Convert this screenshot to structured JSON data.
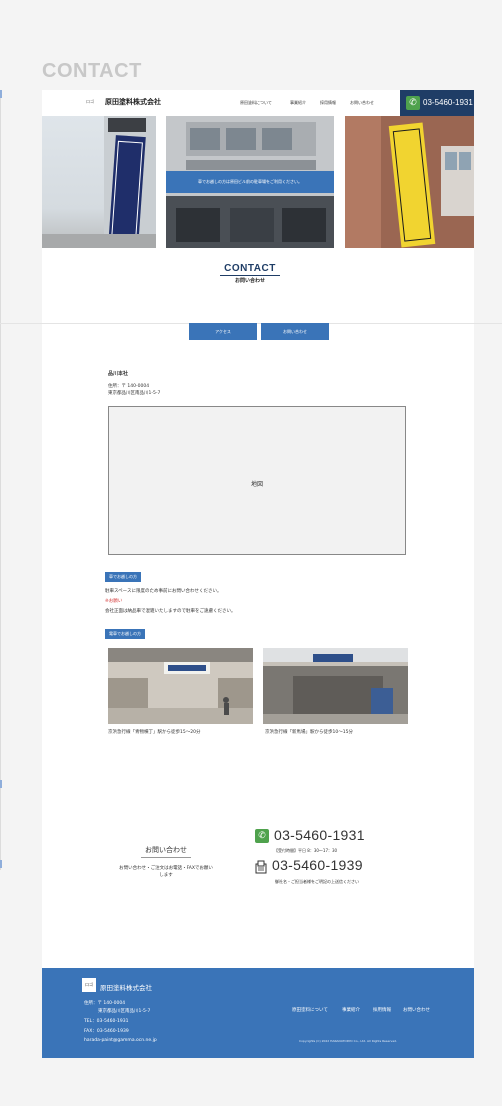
{
  "page_label": "CONTACT",
  "header": {
    "logo": "ロゴ",
    "brand": "原田塗料株式会社",
    "nav": [
      "原田塗料について",
      "事業紹介",
      "採用情報",
      "お問い合わせ"
    ],
    "tel": "03-5460-1931"
  },
  "hero": {
    "notice": "車でお越しの方は原田ビル前の駐車場をご利用ください。"
  },
  "section": {
    "title_en": "CONTACT",
    "title_jp": "お問い合わせ"
  },
  "tabs": [
    "アクセス",
    "お問い合わせ"
  ],
  "access": {
    "branch": "品川本社",
    "zip": "住所：〒 140-0004",
    "address": "東京都品川区南品川1-5-7",
    "map_label": "地図",
    "car_label": "車でお越しの方",
    "car_text1": "駐車スペースに限度のため事前にお問い合わせください。",
    "car_warning": "※お願い",
    "car_text2": "会社正面は納品車で混雑いたしますので駐車をご遠慮ください。",
    "train_label": "電車でお越しの方",
    "train_caption1": "京浜急行線「青物横丁」駅から徒歩15〜20分",
    "train_caption2": "京浜急行線「新馬場」駅から徒歩10〜15分"
  },
  "contact": {
    "card_title": "お問い合わせ",
    "card_text": "お問い合わせ・ご注文はお電話・FAXでお願いします",
    "tel": "03-5460-1931",
    "hours": "【受付時間】平日 8：30〜17：30",
    "fax": "03-5460-1939",
    "fax_note": "御社名・ご担当者様をご明記の上送信ください"
  },
  "footer": {
    "logo": "ロゴ",
    "brand": "原田塗料株式会社",
    "zip": "住所：〒 140-0004",
    "address": "東京都品川区南品川1-5-7",
    "tel": "TEL：03-5460-1931",
    "fax": "FAX：03-5460-1939",
    "email": "harada-paint@gamma.ocn.ne.jp",
    "nav": [
      "原田塗料について",
      "事業紹介",
      "採用情報",
      "お問い合わせ"
    ],
    "copyright": "Copyrights (C) 2022 HARADATORYO Co., Ltd. All Rights Reserved."
  },
  "colors": {
    "navy": "#1f3d66",
    "blue": "#3a74b8",
    "green": "#4fa24d",
    "warning": "#d43a3a"
  }
}
